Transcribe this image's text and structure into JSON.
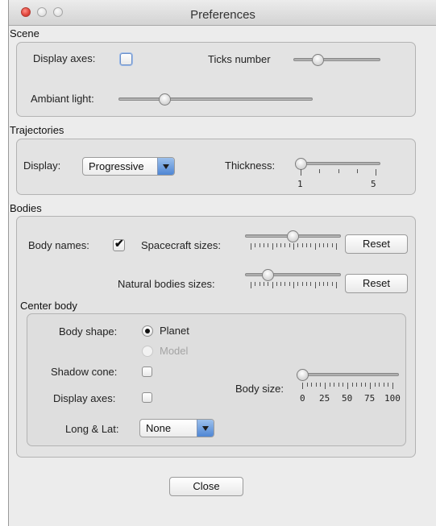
{
  "window": {
    "title": "Preferences"
  },
  "scene": {
    "section_label": "Scene",
    "display_axes_label": "Display axes:",
    "display_axes_checked": false,
    "ticks_number_label": "Ticks number",
    "ticks_number_level": 0.25,
    "ambient_light_label": "Ambiant light:",
    "ambient_light_level": 0.22
  },
  "trajectories": {
    "section_label": "Trajectories",
    "display_label": "Display:",
    "display_value": "Progressive",
    "thickness_label": "Thickness:",
    "thickness_value": 1,
    "thickness_min_label": "1",
    "thickness_max_label": "5"
  },
  "bodies": {
    "section_label": "Bodies",
    "body_names_label": "Body names:",
    "body_names_checked": true,
    "spacecraft_sizes_label": "Spacecraft sizes:",
    "spacecraft_sizes_level": 0.5,
    "natural_bodies_sizes_label": "Natural bodies sizes:",
    "natural_bodies_sizes_level": 0.2,
    "reset_label": "Reset",
    "center_body": {
      "section_label": "Center body",
      "body_shape_label": "Body shape:",
      "planet_label": "Planet",
      "model_label": "Model",
      "body_shape_selected": "Planet",
      "shadow_cone_label": "Shadow cone:",
      "shadow_cone_checked": false,
      "display_axes_label": "Display axes:",
      "display_axes_checked": false,
      "long_lat_label": "Long & Lat:",
      "long_lat_value": "None",
      "body_size_label": "Body size:",
      "body_size_value": 0,
      "body_size_tick_labels": [
        "0",
        "25",
        "50",
        "75",
        "100"
      ]
    }
  },
  "footer": {
    "close_label": "Close"
  },
  "colors": {
    "close_button": "#e0443a",
    "combo_accent": "#4f86d4",
    "panel_bg": "#ececec"
  },
  "icons": {
    "checkmark": "check-icon",
    "dropdown": "chevron-down-icon"
  }
}
